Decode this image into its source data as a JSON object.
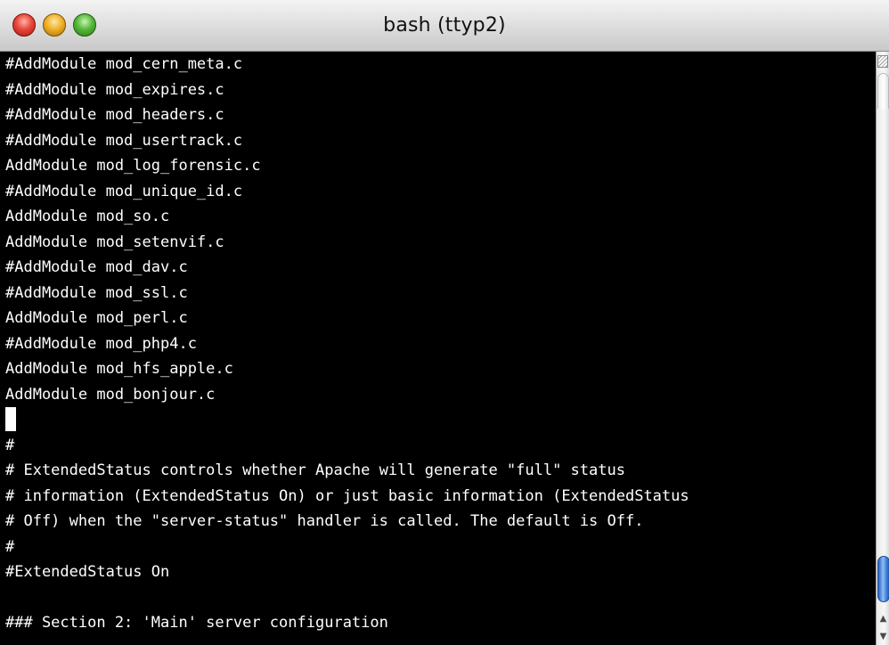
{
  "window": {
    "title": "bash (ttyp2)"
  },
  "terminal": {
    "lines": [
      "#AddModule mod_cern_meta.c",
      "#AddModule mod_expires.c",
      "#AddModule mod_headers.c",
      "#AddModule mod_usertrack.c",
      "AddModule mod_log_forensic.c",
      "#AddModule mod_unique_id.c",
      "AddModule mod_so.c",
      "AddModule mod_setenvif.c",
      "#AddModule mod_dav.c",
      "#AddModule mod_ssl.c",
      "AddModule mod_perl.c",
      "#AddModule mod_php4.c",
      "AddModule mod_hfs_apple.c",
      "AddModule mod_bonjour.c",
      "",
      "#",
      "# ExtendedStatus controls whether Apache will generate \"full\" status",
      "# information (ExtendedStatus On) or just basic information (ExtendedStatus",
      "# Off) when the \"server-status\" handler is called. The default is Off.",
      "#",
      "#ExtendedStatus On",
      "",
      "### Section 2: 'Main' server configuration"
    ]
  },
  "icons": {
    "close": "close-button-icon",
    "minimize": "minimize-button-icon",
    "zoom": "zoom-button-icon",
    "scroll_up": "arrow-up-icon",
    "scroll_down": "arrow-down-icon"
  },
  "colors": {
    "terminal_background": "#000000",
    "terminal_text": "#ffffff",
    "close": "#e8463a",
    "minimize": "#f0b127",
    "zoom": "#57b83a",
    "scroll_thumb": "#4c8be0"
  }
}
